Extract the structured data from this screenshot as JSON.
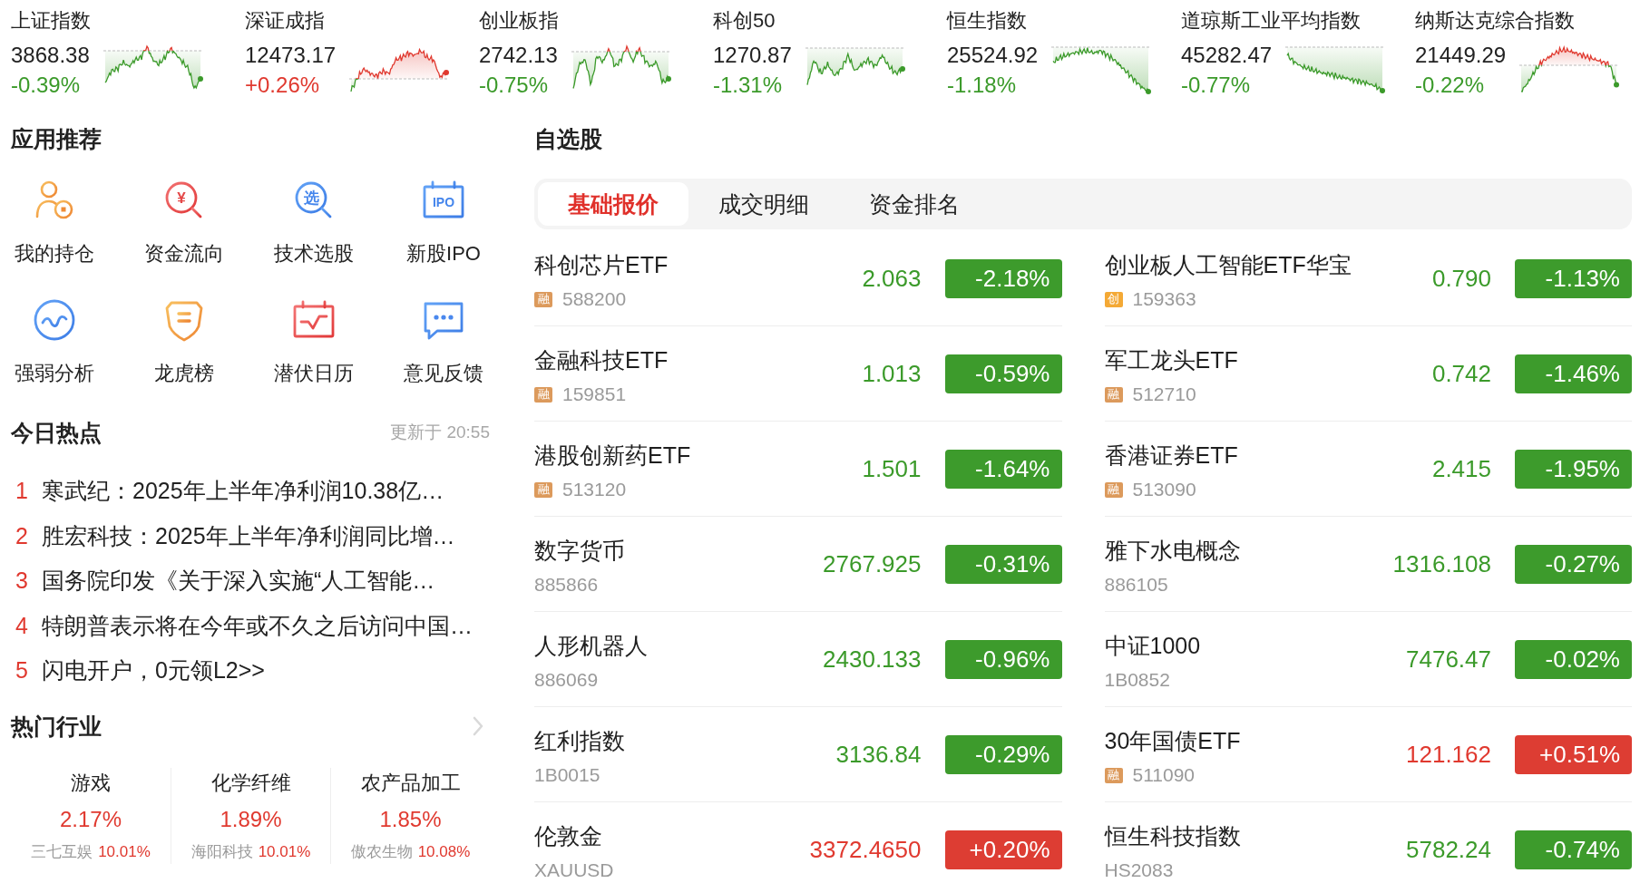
{
  "indices": [
    {
      "name": "上证指数",
      "price": "3868.38",
      "change": "-0.39%",
      "rising": false
    },
    {
      "name": "深证成指",
      "price": "12473.17",
      "change": "+0.26%",
      "rising": true
    },
    {
      "name": "创业板指",
      "price": "2742.13",
      "change": "-0.75%",
      "rising": false
    },
    {
      "name": "科创50",
      "price": "1270.87",
      "change": "-1.31%",
      "rising": false
    },
    {
      "name": "恒生指数",
      "price": "25524.92",
      "change": "-1.18%",
      "rising": false
    },
    {
      "name": "道琼斯工业平均指数",
      "price": "45282.47",
      "change": "-0.77%",
      "rising": false
    },
    {
      "name": "纳斯达克综合指数",
      "price": "21449.29",
      "change": "-0.22%",
      "rising": false
    }
  ],
  "apps": {
    "title": "应用推荐",
    "items": [
      {
        "label": "我的持仓"
      },
      {
        "label": "资金流向",
        "icon_text": "¥"
      },
      {
        "label": "技术选股",
        "icon_text": "选"
      },
      {
        "label": "新股IPO",
        "icon_text": "IPO"
      },
      {
        "label": "强弱分析"
      },
      {
        "label": "龙虎榜"
      },
      {
        "label": "潜伏日历"
      },
      {
        "label": "意见反馈"
      }
    ]
  },
  "hot_news": {
    "title": "今日热点",
    "updated": "更新于 20:55",
    "items": [
      {
        "rank": "1",
        "text": "寒武纪：2025年上半年净利润10.38亿…"
      },
      {
        "rank": "2",
        "text": "胜宏科技：2025年上半年净利润同比增…"
      },
      {
        "rank": "3",
        "text": "国务院印发《关于深入实施“人工智能…"
      },
      {
        "rank": "4",
        "text": "特朗普表示将在今年或不久之后访问中国…"
      },
      {
        "rank": "5",
        "text": "闪电开户，0元领L2>>"
      }
    ]
  },
  "hot_industries": {
    "title": "热门行业",
    "items": [
      {
        "name": "游戏",
        "change": "2.17%",
        "rising": true,
        "leader": "三七互娱",
        "leader_change": "10.01%",
        "leader_rising": true
      },
      {
        "name": "化学纤维",
        "change": "1.89%",
        "rising": true,
        "leader": "海阳科技",
        "leader_change": "10.01%",
        "leader_rising": true
      },
      {
        "name": "农产品加工",
        "change": "1.85%",
        "rising": true,
        "leader": "傲农生物",
        "leader_change": "10.08%",
        "leader_rising": true
      }
    ]
  },
  "watchlist": {
    "title": "自选股",
    "tabs": [
      {
        "label": "基础报价",
        "selected": true
      },
      {
        "label": "成交明细",
        "selected": false
      },
      {
        "label": "资金排名",
        "selected": false
      }
    ],
    "stocks": [
      {
        "name": "科创芯片ETF",
        "badge": {
          "text": "融",
          "color": "#dc9a5c"
        },
        "code": "588200",
        "price": "2.063",
        "change": "-2.18%",
        "rising": false
      },
      {
        "name": "创业板人工智能ETF华宝",
        "badge": {
          "text": "创",
          "color": "#f4a935"
        },
        "code": "159363",
        "price": "0.790",
        "change": "-1.13%",
        "rising": false
      },
      {
        "name": "金融科技ETF",
        "badge": {
          "text": "融",
          "color": "#dc9a5c"
        },
        "code": "159851",
        "price": "1.013",
        "change": "-0.59%",
        "rising": false
      },
      {
        "name": "军工龙头ETF",
        "badge": {
          "text": "融",
          "color": "#dc9a5c"
        },
        "code": "512710",
        "price": "0.742",
        "change": "-1.46%",
        "rising": false
      },
      {
        "name": "港股创新药ETF",
        "badge": {
          "text": "融",
          "color": "#dc9a5c"
        },
        "code": "513120",
        "price": "1.501",
        "change": "-1.64%",
        "rising": false
      },
      {
        "name": "香港证券ETF",
        "badge": {
          "text": "融",
          "color": "#dc9a5c"
        },
        "code": "513090",
        "price": "2.415",
        "change": "-1.95%",
        "rising": false
      },
      {
        "name": "数字货币",
        "code": "885866",
        "price": "2767.925",
        "change": "-0.31%",
        "rising": false
      },
      {
        "name": "雅下水电概念",
        "code": "886105",
        "price": "1316.108",
        "change": "-0.27%",
        "rising": false
      },
      {
        "name": "人形机器人",
        "code": "886069",
        "price": "2430.133",
        "change": "-0.96%",
        "rising": false
      },
      {
        "name": "中证1000",
        "code": "1B0852",
        "price": "7476.47",
        "change": "-0.02%",
        "rising": false
      },
      {
        "name": "红利指数",
        "code": "1B0015",
        "price": "3136.84",
        "change": "-0.29%",
        "rising": false
      },
      {
        "name": "30年国债ETF",
        "badge": {
          "text": "融",
          "color": "#dc9a5c"
        },
        "code": "511090",
        "price": "121.162",
        "change": "+0.51%",
        "rising": true
      },
      {
        "name": "伦敦金",
        "code": "XAUUSD",
        "price": "3372.4650",
        "change": "+0.20%",
        "rising": true
      },
      {
        "name": "恒生科技指数",
        "code": "HS2083",
        "price": "5782.24",
        "change": "-0.74%",
        "rising": false
      }
    ]
  }
}
